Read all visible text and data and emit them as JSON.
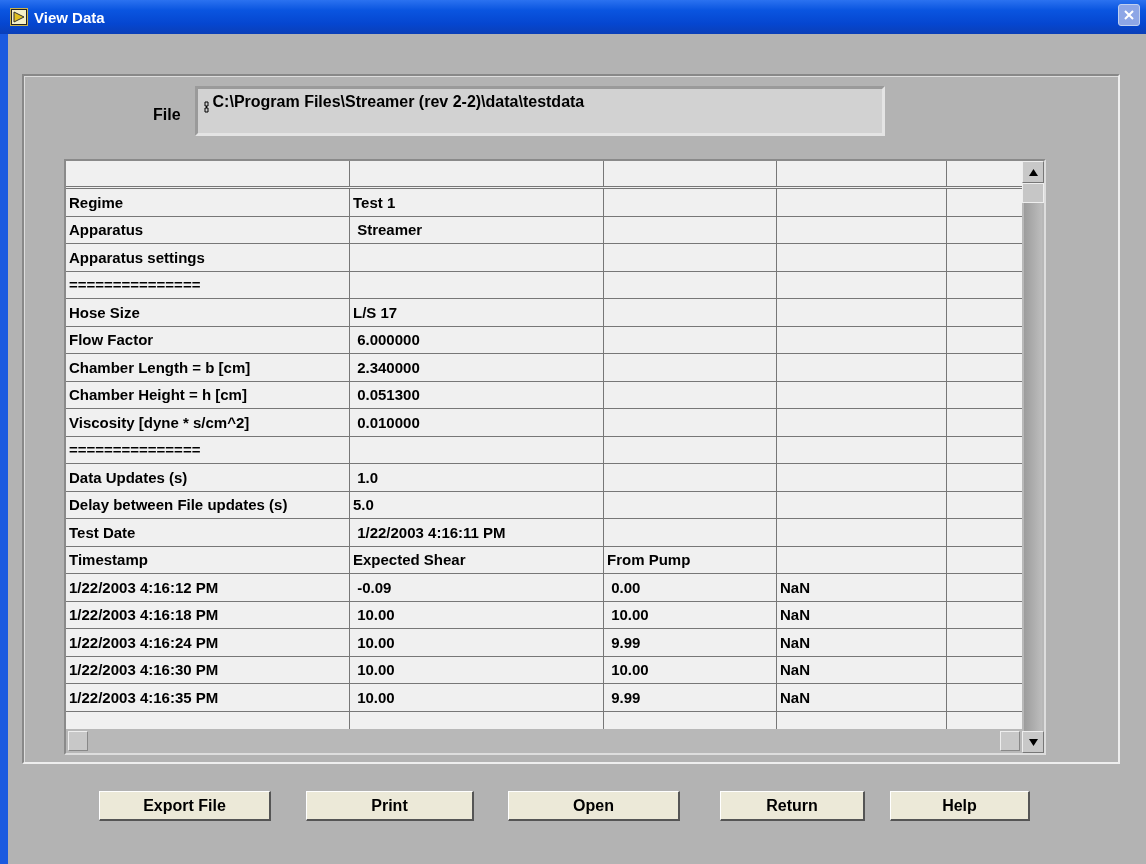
{
  "window": {
    "title": "View Data"
  },
  "file": {
    "label": "File",
    "path": "C:\\Program Files\\Streamer (rev 2-2)\\data\\testdata"
  },
  "table": {
    "rows": [
      {
        "cells": [
          "Regime",
          "Test 1"
        ]
      },
      {
        "cells": [
          "Apparatus",
          " Streamer"
        ]
      },
      {
        "cells": [
          "Apparatus settings"
        ]
      },
      {
        "cells": [
          "==============="
        ]
      },
      {
        "cells": [
          "Hose Size",
          "L/S 17"
        ]
      },
      {
        "cells": [
          "Flow Factor",
          " 6.000000"
        ]
      },
      {
        "cells": [
          "Chamber Length = b [cm]",
          " 2.340000"
        ]
      },
      {
        "cells": [
          "Chamber Height = h [cm]",
          " 0.051300"
        ]
      },
      {
        "cells": [
          "Viscosity [dyne * s/cm^2]",
          " 0.010000"
        ]
      },
      {
        "cells": [
          "==============="
        ]
      },
      {
        "cells": [
          "Data Updates (s)",
          " 1.0"
        ]
      },
      {
        "cells": [
          "Delay between File updates (s)",
          "5.0"
        ]
      },
      {
        "cells": [
          "Test Date",
          " 1/22/2003 4:16:11 PM"
        ]
      },
      {
        "cells": [
          "Timestamp",
          "Expected Shear",
          "From Pump"
        ]
      },
      {
        "cells": [
          "1/22/2003 4:16:12 PM",
          " -0.09",
          " 0.00",
          "NaN"
        ]
      },
      {
        "cells": [
          "1/22/2003 4:16:18 PM",
          " 10.00",
          " 10.00",
          "NaN"
        ]
      },
      {
        "cells": [
          "1/22/2003 4:16:24 PM",
          " 10.00",
          " 9.99",
          "NaN"
        ]
      },
      {
        "cells": [
          "1/22/2003 4:16:30 PM",
          " 10.00",
          " 10.00",
          "NaN"
        ]
      },
      {
        "cells": [
          "1/22/2003 4:16:35 PM",
          " 10.00",
          " 9.99",
          "NaN"
        ]
      }
    ]
  },
  "buttons": [
    "Export File",
    "Print",
    "Open",
    "Return",
    "Help"
  ]
}
